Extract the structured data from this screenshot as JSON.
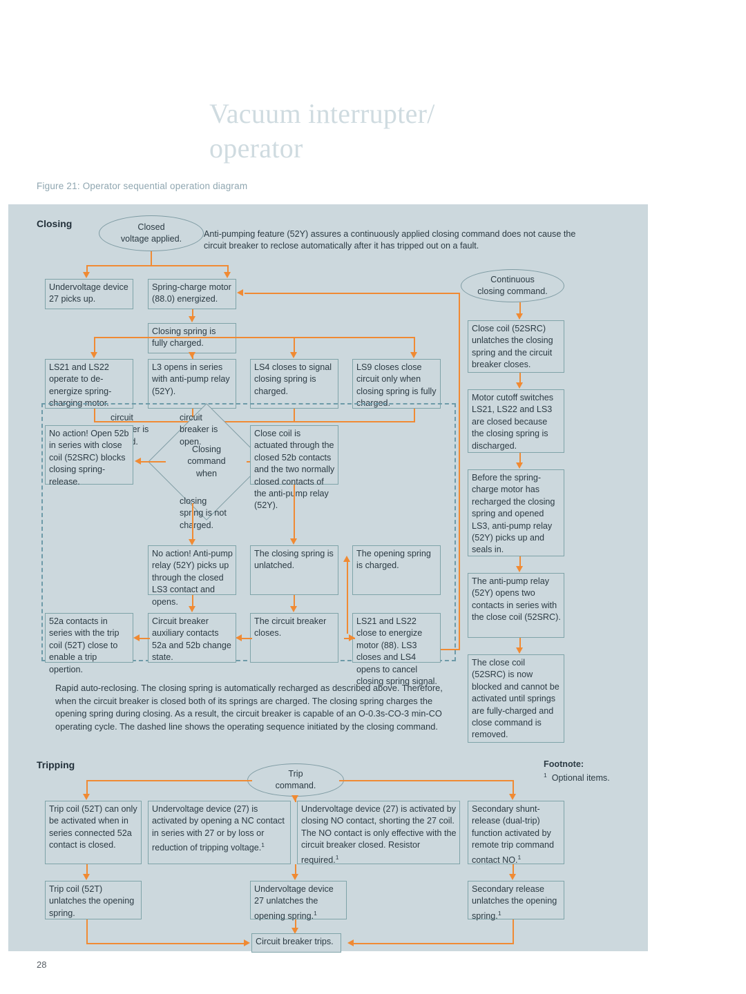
{
  "page": {
    "title": "Vacuum interrupter/\noperator",
    "figure_caption": "Figure 21: Operator sequential operation diagram",
    "page_number": "28",
    "accent_color": "#f08a33",
    "panel_color": "#ccd8dd",
    "box_border_color": "#7ea3a8",
    "title_color": "#cfdbe0"
  },
  "closing": {
    "section_label": "Closing",
    "start_node": "Closed\nvoltage applied.",
    "note": "Anti-pumping feature (52Y) assures a continuously applied closing command does not cause the circuit breaker to reclose automatically after it has tripped out on a fault.",
    "continuous_node": "Continuous\nclosing command.",
    "boxes": {
      "undervoltage_27": "Undervoltage device 27 picks up.",
      "spring_charge_motor": "Spring-charge motor (88.0) energized.",
      "closing_spring_charged": "Closing spring is fully charged.",
      "ls21_ls22_deenergize": "LS21 and LS22 operate to de-energize spring-charging motor.",
      "l3_opens": "L3 opens in series with anti-pump relay (52Y).",
      "ls4_closes": "LS4 closes to signal closing spring is charged.",
      "ls9_closes": "LS9 closes close circuit only when closing spring is fully charged.",
      "no_action_52b": "No action! Open 52b in series with close coil (52SRC) blocks closing spring-release.",
      "close_coil_actuated": "Close coil is actuated through the closed 52b contacts and the two normally closed contacts of the anti-pump relay (52Y).",
      "no_action_antipump": "No action! Anti-pump relay (52Y) picks up through the closed LS3 contact and opens.",
      "closing_spring_unlatched": "The closing spring is unlatched.",
      "opening_spring_charged": "The opening spring is charged.",
      "contacts_52a": "52a contacts in series with the trip coil (52T) close to enable a trip opertion.",
      "aux_contacts": "Circuit breaker auxiliary contacts 52a and 52b change state.",
      "breaker_closes": "The circuit breaker closes.",
      "ls21_ls22_close": "LS21 and LS22 close to energize motor (88). LS3 closes and LS4 opens to cancel closing spring signal."
    },
    "decision": {
      "label": "Closing\ncommand\nwhen",
      "branch_left": "circuit\nbreaker is\nclosed.",
      "branch_right": "circuit\nbreaker is\nopen.",
      "branch_down": "closing\nspring is not\ncharged."
    },
    "right_column": [
      "Close coil (52SRC) unlatches the closing spring and the circuit breaker closes.",
      "Motor cutoff switches LS21, LS22 and LS3 are closed because  the closing spring is discharged.",
      "Before the spring-charge motor has recharged the closing spring and opened LS3, anti-pump relay (52Y) picks up and seals in.",
      "The anti-pump relay (52Y) opens two contacts in series with the close coil (52SRC).",
      "The close coil (52SRC) is now blocked and cannot be activated until springs are fully-charged and close command is removed."
    ],
    "paragraph": "Rapid auto-reclosing. The closing spring is automatically recharged as described above. Therefore, when the circuit breaker is closed both of its springs are charged. The closing spring charges the opening spring during closing. As a result, the circuit breaker is capable of an O-0.3s-CO-3 min-CO operating cycle. The dashed line shows the operating sequence initiated by the closing command."
  },
  "tripping": {
    "section_label": "Tripping",
    "start_node": "Trip\ncommand.",
    "footnote_title": "Footnote:",
    "footnote_text": "Optional items.",
    "footnote_marker": "1",
    "boxes": {
      "trip_coil_52t": "Trip coil (52T) can only be activated when in series connected 52a contact is closed.",
      "uv_nc": "Undervoltage device (27) is activated by opening a NC contact in series with 27 or by loss or reduction of tripping voltage.",
      "uv_no": "Undervoltage device (27) is activated by closing NO contact, shorting the 27 coil. The NO contact is only effective with the circuit breaker closed. Resistor required.",
      "secondary_shunt": "Secondary shunt-release (dual-trip) function activated by remote trip command contact NO.",
      "trip_coil_unlatches": "Trip coil (52T) unlatches the opening spring.",
      "uv_unlatches": "Undervoltage device 27 unlatches the opening spring.",
      "secondary_unlatches": "Secondary release unlatches the opening spring.",
      "breaker_trips": "Circuit breaker trips."
    }
  }
}
